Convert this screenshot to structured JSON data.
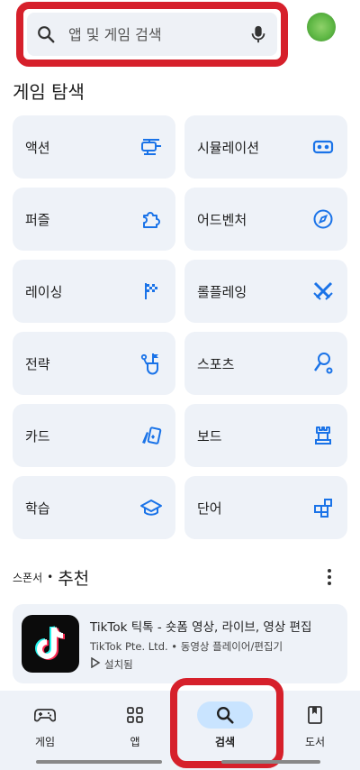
{
  "search": {
    "placeholder": "앱 및 게임 검색"
  },
  "section": {
    "title": "게임 탐색"
  },
  "categories": [
    {
      "label": "액션",
      "icon": "helicopter-icon"
    },
    {
      "label": "시뮬레이션",
      "icon": "vr-goggles-icon"
    },
    {
      "label": "퍼즐",
      "icon": "puzzle-piece-icon"
    },
    {
      "label": "어드벤처",
      "icon": "compass-icon"
    },
    {
      "label": "레이싱",
      "icon": "checkered-flag-icon"
    },
    {
      "label": "롤플레잉",
      "icon": "crossed-swords-icon"
    },
    {
      "label": "전략",
      "icon": "strategy-flag-icon"
    },
    {
      "label": "스포츠",
      "icon": "racket-icon"
    },
    {
      "label": "카드",
      "icon": "cards-icon"
    },
    {
      "label": "보드",
      "icon": "chess-rook-icon"
    },
    {
      "label": "학습",
      "icon": "graduation-cap-icon"
    },
    {
      "label": "단어",
      "icon": "word-blocks-icon"
    }
  ],
  "sponsored": {
    "small_label": "스폰서",
    "separator": "•",
    "title": "추천"
  },
  "app": {
    "name": "TikTok 틱톡 - 숏폼 영상, 라이브, 영상 편집",
    "meta": "TikTok Pte. Ltd. • 동영상 플레이어/편집기",
    "status": "설치됨"
  },
  "nav": {
    "items": [
      {
        "label": "게임",
        "icon": "gamepad-icon"
      },
      {
        "label": "앱",
        "icon": "apps-grid-icon"
      },
      {
        "label": "검색",
        "icon": "search-icon",
        "active": true
      },
      {
        "label": "도서",
        "icon": "bookmark-book-icon"
      }
    ]
  },
  "colors": {
    "accent": "#1a73e8",
    "highlight": "#d6202b",
    "tile_bg": "#eef2f8",
    "active_pill": "#c9e4ff"
  }
}
